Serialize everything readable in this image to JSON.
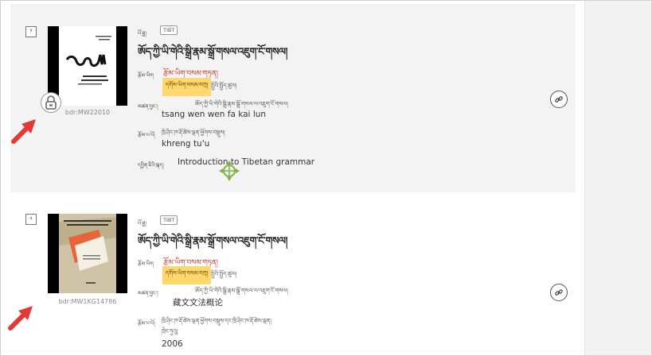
{
  "results": [
    {
      "index": "༡",
      "label_top": "པོ་ཐྱ།",
      "script_badge": "TIBT",
      "title": "ཨོད་ཀྱི་ཡི་གེའི་སྒྲི་རྣམ་སྒྲོ་གསལ་འཇུག་ངོ་གསལ།",
      "field_type_label": "རྩོམ་ཡིག",
      "red_value": "རྩོམ་ཡིག་བསམ་གཏན།",
      "highlight_value": "དགོས་ཡིག་བསམ་བཀྲ།",
      "small_note": "སྤྱིའི་སྤྱོད་ཚུལ།",
      "title_label": "མཚན་བྱང་།",
      "tibetan_title_small": "ཨོད་ཀྱི་ཡི་གེའི་སྒྲི་རྣམ་སྒྲོ་གསལ་ལ་འཇུག་ངོ་གསལ།",
      "transliteration": "tsang wen wen fa kai lun",
      "author_label": "རྩོམ་པ་པོ།",
      "author_tibetan_small": "ཁྲི་ཤིང་ཁ་རྡོ་ཚེས་ལྡན་ཕྱོགས་བསྡུས།",
      "author_value": "khreng tu'u",
      "english_label": "དབྱིན་ཇིའི་སྐད།",
      "english_title": "Introduction to Tibetan grammar",
      "id": "bdr:MW22010"
    },
    {
      "index": "༢",
      "label_top": "པོ་ཐྱ།",
      "script_badge": "TIBT",
      "title": "ཨོད་ཀྱི་ཡི་གེའི་སྒྲི་རྣམ་སྒྲོ་གསལ་འཇུག་ངོ་གསལ།",
      "field_type_label": "རྩོམ་ཡིག",
      "red_value": "རྩོམ་ཡིག་བསམ་གཏན།",
      "highlight_value": "དགོས་ཡིག་བསམ་བཀྲ།",
      "small_note": "སྤྱིའི་སྤྱོད་ཚུལ།",
      "title_label": "མཚན་བྱང་།",
      "tibetan_title_small": "ཨོད་ཀྱི་ཡི་གེའི་སྒྲི་རྣམ་སྒྲོ་གསལ་ལ་འཇུག་ངོ་གསལ།",
      "chinese_title": "藏文文法概论",
      "author_label": "རྩོམ་པ་པོ།",
      "author_tibetan_small": "ཁྲི་ཤིང་ཁ་རྡོ་ཚེས་ལྡན་ཕྱོགས་བསྡུས་དང་ཁྲི་ཤིང་ཁ་རྡོ་ཚེས་ལྡན།",
      "author_city": "ཁྲེང་ཏུའུ།",
      "year": "2006",
      "id": "bdr:MW1KG14786"
    }
  ],
  "colors": {
    "red_text": "#c23a2a",
    "highlight": "#ffd76a",
    "arrow": "#e53935",
    "move_cursor": "#7cb342"
  }
}
